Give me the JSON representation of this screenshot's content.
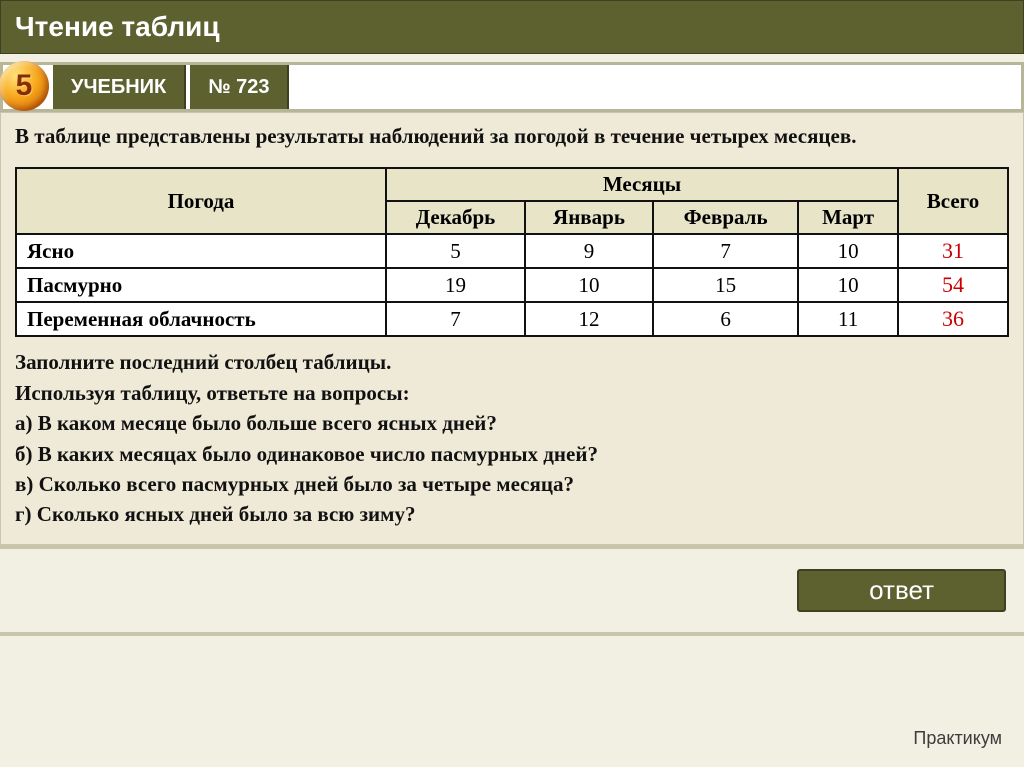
{
  "title": "Чтение таблиц",
  "badge": "5",
  "tabs": {
    "textbook": "УЧЕБНИК",
    "number": "№ 723"
  },
  "intro": "В таблице представлены результаты наблюдений за погодой в течение четырех месяцев.",
  "table": {
    "weather_header": "Погода",
    "months_header": "Месяцы",
    "total_header": "Всего",
    "months": [
      "Декабрь",
      "Январь",
      "Февраль",
      "Март"
    ],
    "rows": [
      {
        "label": "Ясно",
        "values": [
          "5",
          "9",
          "7",
          "10"
        ],
        "total": "31"
      },
      {
        "label": "Пасмурно",
        "values": [
          "19",
          "10",
          "15",
          "10"
        ],
        "total": "54"
      },
      {
        "label": "Переменная облачность",
        "values": [
          "7",
          "12",
          "6",
          "11"
        ],
        "total": "36"
      }
    ]
  },
  "tasks": {
    "l1": "Заполните последний столбец таблицы.",
    "l2": "Используя таблицу, ответьте на вопросы:",
    "a": "а) В каком месяце было больше всего ясных дней?",
    "b": "б) В каких месяцах было одинаковое число пасмурных дней?",
    "c": "в) Сколько всего пасмурных дней было за четыре месяца?",
    "d": "г) Сколько ясных дней было за всю зиму?"
  },
  "answer_button": "ответ",
  "footer": "Практикум"
}
